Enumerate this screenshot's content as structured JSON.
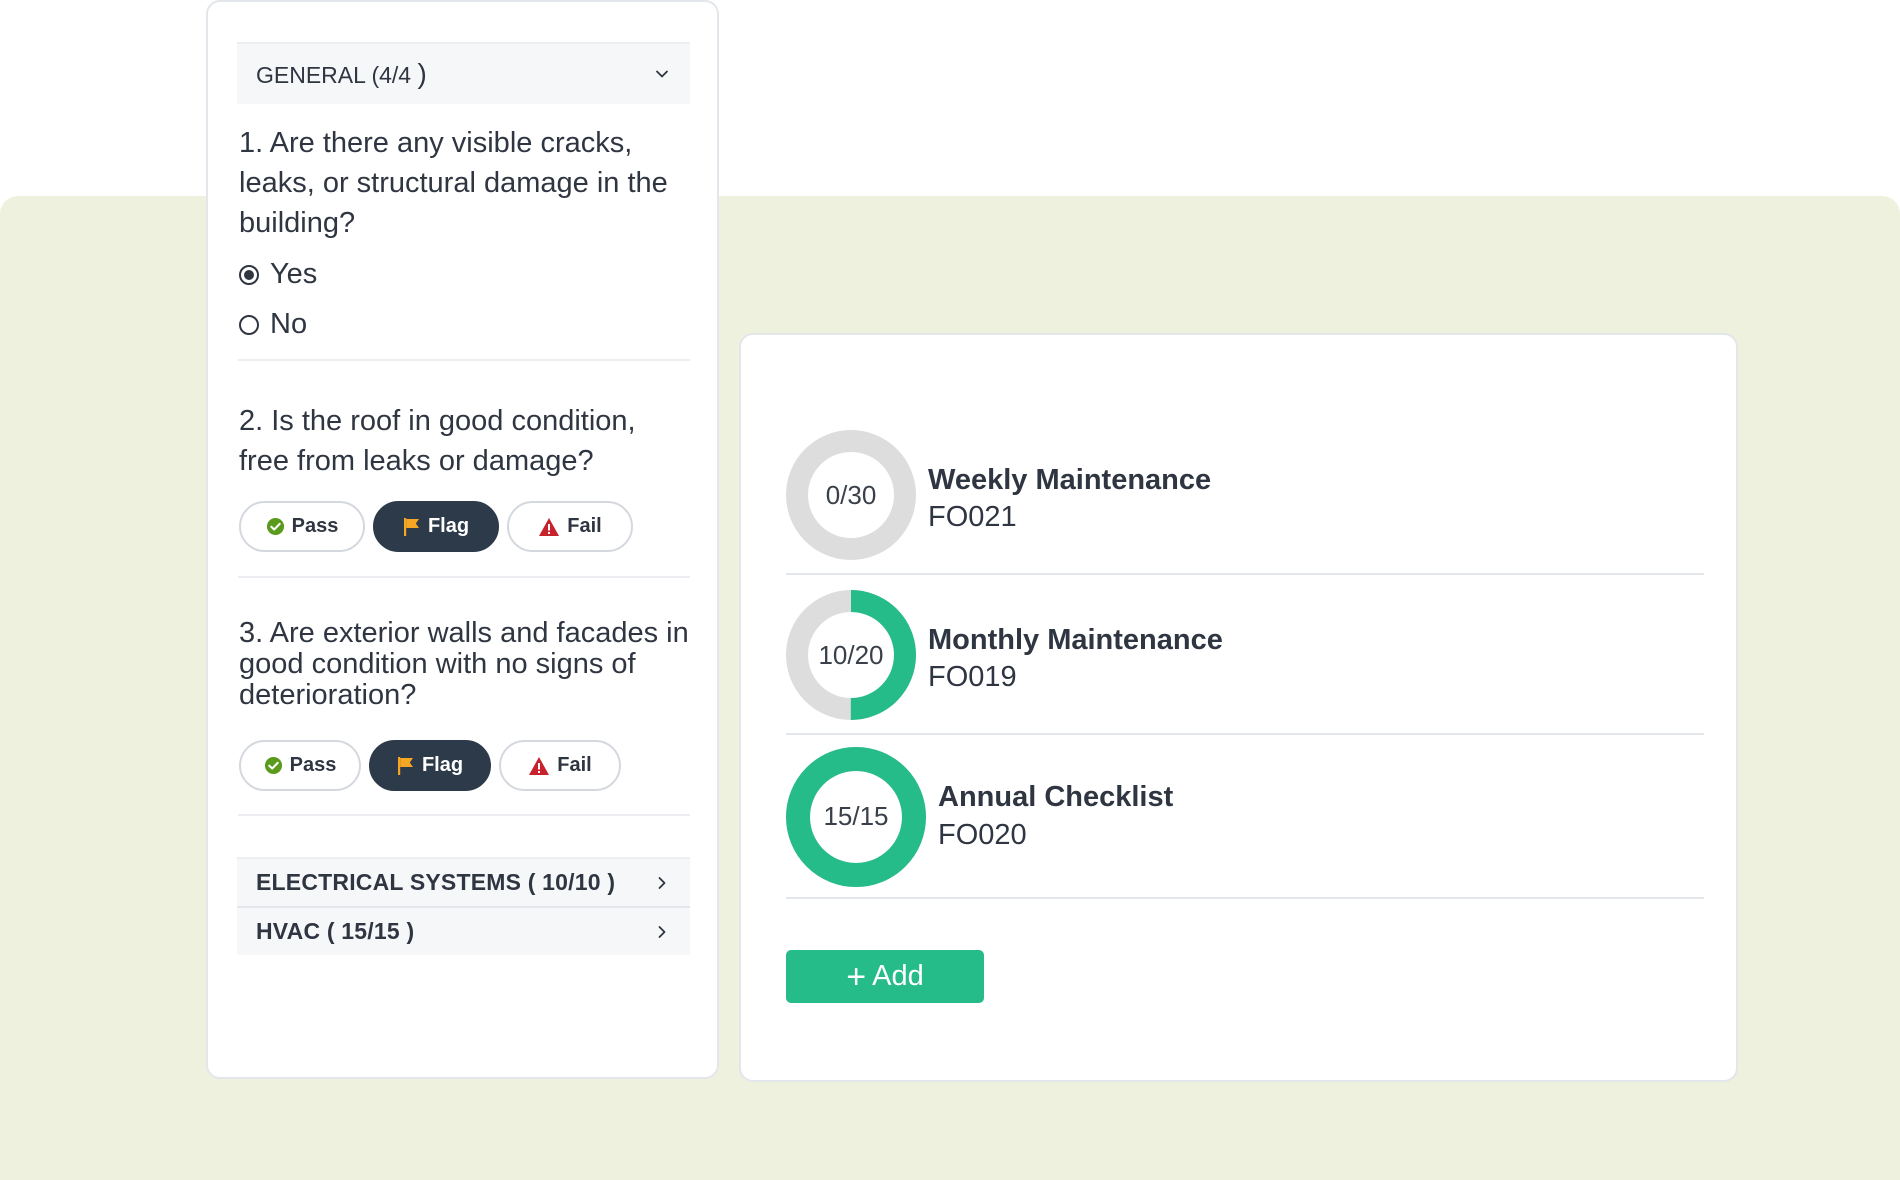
{
  "colors": {
    "background_tint": "#eef1dd",
    "accent_green": "#26bc8a",
    "ring_track": "#dddddd",
    "flag_active_bg": "#2d3a4a",
    "pass_icon": "#5a9a1c",
    "flag_icon": "#f5a623",
    "fail_icon": "#c8232c"
  },
  "inspection": {
    "general_section": {
      "label": "GENERAL (4/4",
      "paren_close": ")"
    },
    "q1": {
      "text": "1. Are there any visible cracks, leaks, or structural damage in the building?",
      "options": [
        {
          "label": "Yes",
          "selected": true
        },
        {
          "label": "No",
          "selected": false
        }
      ]
    },
    "q2": {
      "text": "2. Is the roof in good condition, free from leaks or damage?",
      "buttons": {
        "pass": "Pass",
        "flag": "Flag",
        "fail": "Fail"
      },
      "selected": "Flag"
    },
    "q3": {
      "text": "3. Are exterior walls and facades in good condition with no signs of deterioration?",
      "buttons": {
        "pass": "Pass",
        "flag": "Flag",
        "fail": "Fail"
      },
      "selected": "Flag"
    },
    "sections": [
      {
        "label": "ELECTRICAL SYSTEMS ( 10/10 )"
      },
      {
        "label": "HVAC ( 15/15 )"
      }
    ]
  },
  "checklists": {
    "items": [
      {
        "progress_label": "0/30",
        "done": 0,
        "total": 30,
        "title": "Weekly Maintenance",
        "code": "FO021"
      },
      {
        "progress_label": "10/20",
        "done": 10,
        "total": 20,
        "title": "Monthly Maintenance",
        "code": "FO019"
      },
      {
        "progress_label": "15/15",
        "done": 15,
        "total": 15,
        "title": "Annual Checklist",
        "code": "FO020"
      }
    ],
    "add_label": "Add",
    "add_icon": "plus-icon"
  }
}
